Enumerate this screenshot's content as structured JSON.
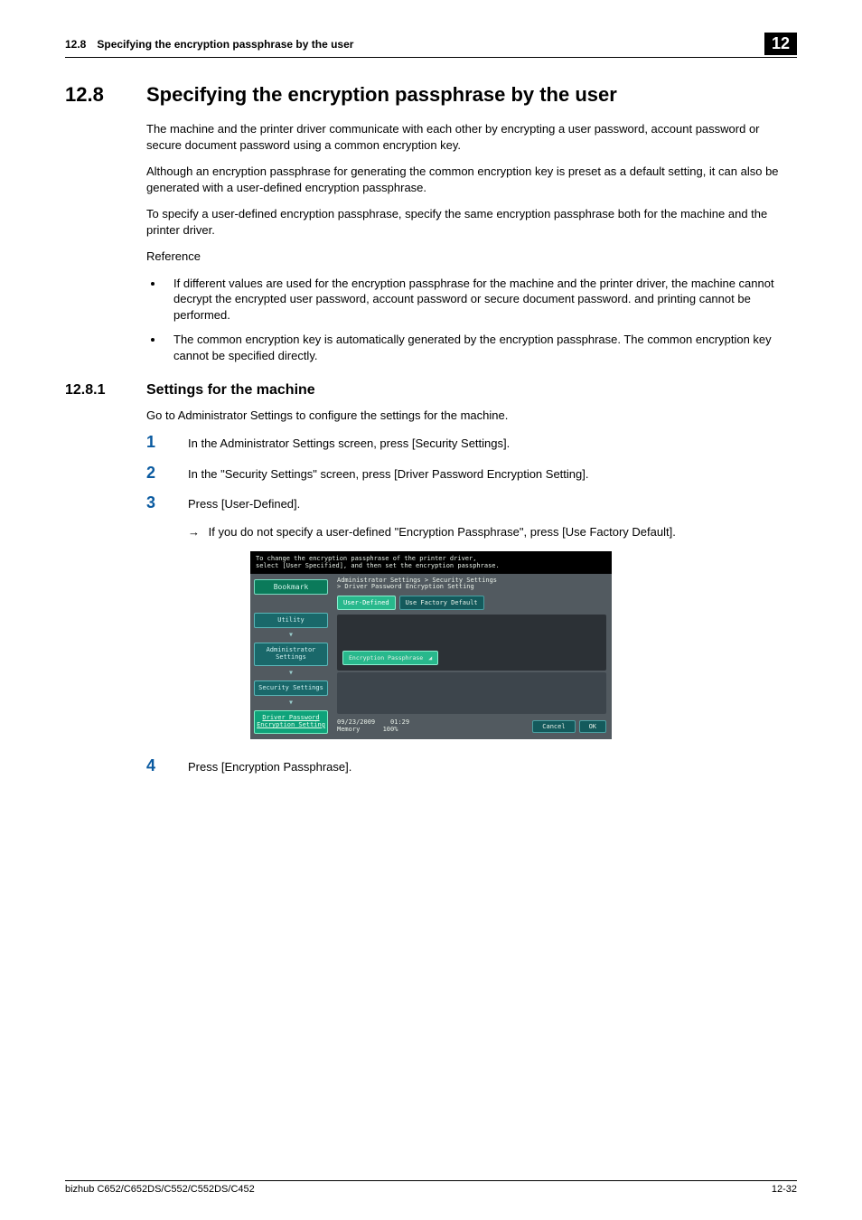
{
  "header": {
    "section_number": "12.8",
    "section_title": "Specifying the encryption passphrase by the user",
    "chapter": "12"
  },
  "h1": {
    "number": "12.8",
    "title": "Specifying the encryption passphrase by the user"
  },
  "intro": {
    "p1": "The machine and the printer driver communicate with each other by encrypting a user password, account password or secure document password using a common encryption key.",
    "p2": "Although an encryption passphrase for generating the common encryption key is preset as a default setting, it can also be generated with a user-defined encryption passphrase.",
    "p3": "To specify a user-defined encryption passphrase, specify the same encryption passphrase both for the machine and the printer driver.",
    "ref_label": "Reference",
    "bullets": [
      "If different values are used for the encryption passphrase for the machine and the printer driver, the machine cannot decrypt the encrypted user password, account password or secure document password. and printing cannot be performed.",
      "The common encryption key is automatically generated by the encryption passphrase. The common encryption key cannot be specified directly."
    ]
  },
  "h2": {
    "number": "12.8.1",
    "title": "Settings for the machine",
    "lead": "Go to Administrator Settings to configure the settings for the machine."
  },
  "steps": [
    {
      "n": "1",
      "text": "In the Administrator Settings screen, press [Security Settings]."
    },
    {
      "n": "2",
      "text": "In the \"Security Settings\" screen, press [Driver Password Encryption Setting]."
    },
    {
      "n": "3",
      "text": "Press [User-Defined]."
    },
    {
      "n": "4",
      "text": "Press [Encryption Passphrase]."
    }
  ],
  "substep3": "If you do not specify a user-defined \"Encryption Passphrase\", press [Use Factory Default].",
  "screenshot": {
    "help1": "To change the encryption passphrase of the printer driver,",
    "help2": "select [User Specified], and then set the encryption passphrase.",
    "bookmark": "Bookmark",
    "nav": {
      "utility": "Utility",
      "admin": "Administrator Settings",
      "security": "Security Settings",
      "driver": "Driver Password Encryption Setting"
    },
    "breadcrumb1": "Administrator Settings > Security Settings",
    "breadcrumb2": "> Driver Password Encryption Setting",
    "tab_user": "User-Defined",
    "tab_factory": "Use Factory Default",
    "enc_btn": "Encryption Passphrase",
    "date": "09/23/2009",
    "time": "01:29",
    "mem_label": "Memory",
    "mem_val": "100%",
    "cancel": "Cancel",
    "ok": "OK"
  },
  "footer": {
    "model": "bizhub C652/C652DS/C552/C552DS/C452",
    "page": "12-32"
  }
}
